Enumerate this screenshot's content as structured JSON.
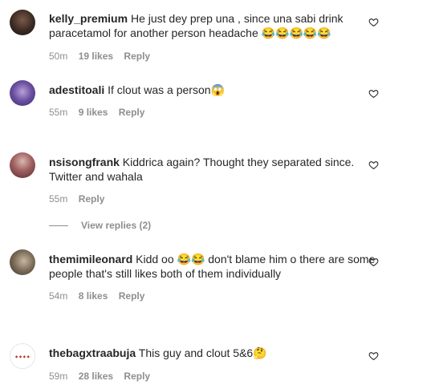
{
  "comments": [
    {
      "username": "kelly_premium",
      "text": "He just dey prep una , since una sabi drink paracetamol for another person headache 😂😂😂😂😂",
      "time": "50m",
      "likes": "19 likes",
      "reply": "Reply"
    },
    {
      "username": "adestitoali",
      "text": "If clout was a person😱",
      "time": "55m",
      "likes": "9 likes",
      "reply": "Reply"
    },
    {
      "username": "nsisongfrank",
      "text": "Kiddrica again? Thought they separated since. Twitter and wahala",
      "time": "55m",
      "reply": "Reply",
      "view_replies": "View replies (2)"
    },
    {
      "username": "themimileonard",
      "text": "Kidd oo 😂😂 don't blame him o there are some people that's still likes both of them individually",
      "time": "54m",
      "likes": "8 likes",
      "reply": "Reply"
    },
    {
      "username": "thebagxtraabuja",
      "text": "This guy and clout 5&6🤔",
      "time": "59m",
      "likes": "28 likes",
      "reply": "Reply"
    }
  ],
  "colors": {
    "text": "#262626",
    "muted": "#8e8e8e"
  },
  "icons": {
    "like": "heart-outline-icon"
  }
}
